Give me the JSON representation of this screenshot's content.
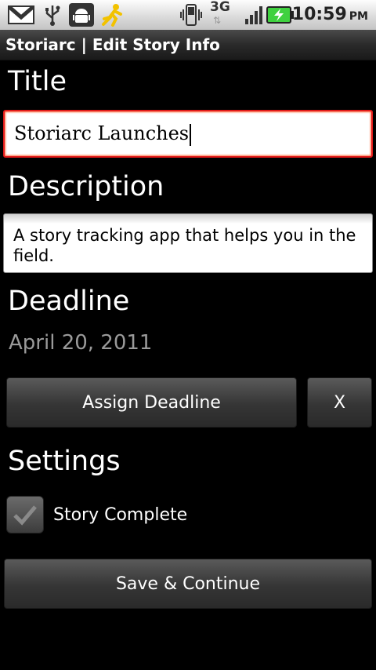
{
  "status_bar": {
    "icons": [
      "gmail-icon",
      "usb-icon",
      "android-debug-icon",
      "aim-running-man-icon",
      "vibrate-phone-icon",
      "signal-icon",
      "battery-charging-icon"
    ],
    "network": "3G",
    "time": "10:59",
    "ampm": "PM"
  },
  "title_bar": {
    "title": "Storiarc | Edit Story Info"
  },
  "form": {
    "title_label": "Title",
    "title_value": "Storiarc Launches",
    "description_label": "Description",
    "description_value": "A story tracking app that helps you in the field.",
    "deadline_label": "Deadline",
    "deadline_value": "April 20, 2011",
    "assign_deadline_button": "Assign Deadline",
    "clear_deadline_button": "X",
    "settings_label": "Settings",
    "story_complete_label": "Story Complete",
    "story_complete_checked": true,
    "save_button": "Save & Continue"
  },
  "colors": {
    "background": "#000000",
    "focus_border": "#e21a1a",
    "battery_green": "#3fd13f",
    "deadline_text": "#9a9a9a"
  }
}
